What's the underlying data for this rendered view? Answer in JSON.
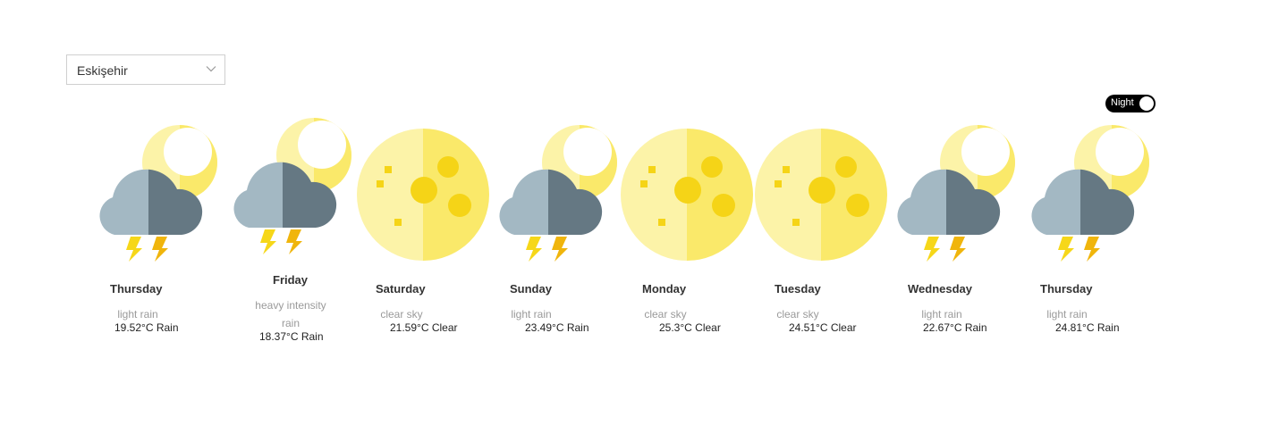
{
  "location_select": {
    "value": "Eskişehir"
  },
  "mode_toggle": {
    "label": "Night",
    "state": "on"
  },
  "forecast": [
    {
      "day": "Thursday",
      "description": "light rain",
      "summary": "19.52°C Rain",
      "icon": "thunder-rain-night-icon"
    },
    {
      "day": "Friday",
      "description": "heavy intensity rain",
      "summary": "18.37°C Rain",
      "icon": "thunder-rain-night-icon"
    },
    {
      "day": "Saturday",
      "description": "clear sky",
      "summary": "21.59°C Clear",
      "icon": "full-moon-icon"
    },
    {
      "day": "Sunday",
      "description": "light rain",
      "summary": "23.49°C Rain",
      "icon": "thunder-rain-night-icon"
    },
    {
      "day": "Monday",
      "description": "clear sky",
      "summary": "25.3°C Clear",
      "icon": "full-moon-icon"
    },
    {
      "day": "Tuesday",
      "description": "clear sky",
      "summary": "24.51°C Clear",
      "icon": "full-moon-icon"
    },
    {
      "day": "Wednesday",
      "description": "light rain",
      "summary": "22.67°C Rain",
      "icon": "thunder-rain-night-icon"
    },
    {
      "day": "Thursday",
      "description": "light rain",
      "summary": "24.81°C Rain",
      "icon": "thunder-rain-night-icon"
    }
  ],
  "colors": {
    "moon_light": "#fcf3a8",
    "moon_dark": "#fae96a",
    "crater": "#f5d417",
    "cloud_light": "#a3b8c3",
    "cloud_dark": "#657883",
    "bolt_light": "#f6d719",
    "bolt_dark": "#f0b50c",
    "toggle_bg": "#000000"
  }
}
